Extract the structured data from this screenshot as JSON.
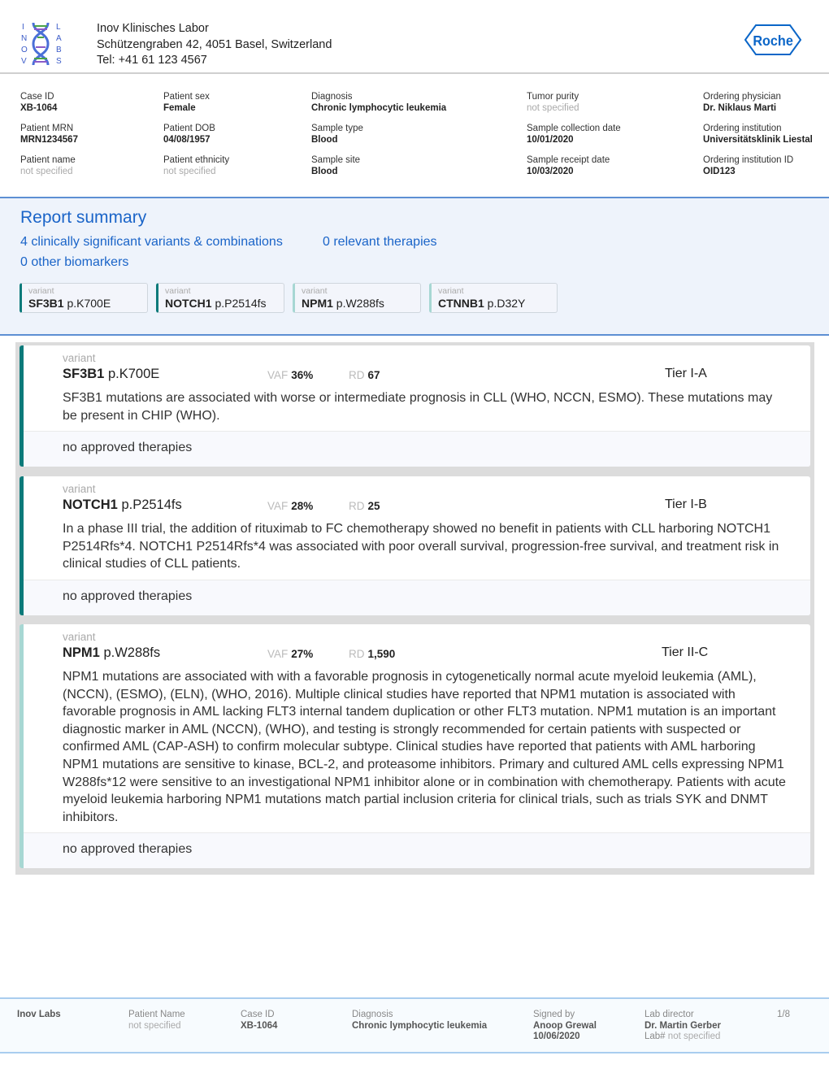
{
  "header": {
    "logo_text": "INOV LABS",
    "lab_name": "Inov Klinisches Labor",
    "address": "Schützengraben 42, 4051 Basel, Switzerland",
    "tel": "Tel: +41 61 123 4567",
    "brand": "Roche"
  },
  "info": [
    {
      "label": "Case ID",
      "value": "XB-1064"
    },
    {
      "label": "Patient sex",
      "value": "Female"
    },
    {
      "label": "Diagnosis",
      "value": "Chronic lymphocytic leukemia"
    },
    {
      "label": "Tumor purity",
      "value": "not specified"
    },
    {
      "label": "Ordering physician",
      "value": "Dr. Niklaus Marti"
    },
    {
      "label": "Patient MRN",
      "value": "MRN1234567"
    },
    {
      "label": "Patient DOB",
      "value": "04/08/1957"
    },
    {
      "label": "Sample type",
      "value": "Blood"
    },
    {
      "label": "Sample collection date",
      "value": "10/01/2020"
    },
    {
      "label": "Ordering institution",
      "value": "Universitätsklinik Liestal"
    },
    {
      "label": "Patient name",
      "value": "not specified"
    },
    {
      "label": "Patient ethnicity",
      "value": "not specified"
    },
    {
      "label": "Sample site",
      "value": "Blood"
    },
    {
      "label": "Sample receipt date",
      "value": "10/03/2020"
    },
    {
      "label": "Ordering institution ID",
      "value": "OID123"
    }
  ],
  "summary": {
    "title": "Report summary",
    "variants_link": "4 clinically significant variants & combinations",
    "therapies_link": "0 relevant therapies",
    "biomarkers_link": "0 other biomarkers",
    "chips": [
      {
        "label": "variant",
        "gene": "SF3B1",
        "change": "p.K700E"
      },
      {
        "label": "variant",
        "gene": "NOTCH1",
        "change": "p.P2514fs"
      },
      {
        "label": "variant",
        "gene": "NPM1",
        "change": "p.W288fs"
      },
      {
        "label": "variant",
        "gene": "CTNNB1",
        "change": "p.D32Y"
      }
    ]
  },
  "colors": {
    "accent": "#1a64c8",
    "tier1": "#0b7a7a",
    "tier2": "#a7d7d3"
  },
  "cards": [
    {
      "label": "variant",
      "gene": "SF3B1",
      "change": "p.K700E",
      "vaf_label": "VAF",
      "vaf": "36%",
      "rd_label": "RD",
      "rd": "67",
      "tier": "Tier I-A",
      "description": "SF3B1 mutations are associated with worse or intermediate prognosis in CLL (WHO, NCCN, ESMO). These mutations may be present in CHIP (WHO).",
      "therapies": "no approved therapies"
    },
    {
      "label": "variant",
      "gene": "NOTCH1",
      "change": "p.P2514fs",
      "vaf_label": "VAF",
      "vaf": "28%",
      "rd_label": "RD",
      "rd": "25",
      "tier": "Tier I-B",
      "description": "In a phase III trial, the addition of rituximab to FC chemotherapy showed no benefit in patients with CLL harboring NOTCH1 P2514Rfs*4. NOTCH1 P2514Rfs*4 was associated with poor overall survival, progression-free survival, and treatment risk in clinical studies of CLL patients.",
      "therapies": "no approved therapies"
    },
    {
      "label": "variant",
      "gene": "NPM1",
      "change": "p.W288fs",
      "vaf_label": "VAF",
      "vaf": "27%",
      "rd_label": "RD",
      "rd": "1,590",
      "tier": "Tier II-C",
      "description": "NPM1 mutations are associated with with a favorable prognosis in cytogenetically normal acute myeloid leukemia (AML), (NCCN), (ESMO), (ELN), (WHO, 2016). Multiple clinical studies have reported that NPM1 mutation is associated with favorable prognosis in AML lacking FLT3 internal tandem duplication or other FLT3 mutation. NPM1 mutation is an important diagnostic marker in AML (NCCN), (WHO), and testing is strongly recommended for certain patients with suspected or confirmed AML (CAP-ASH) to confirm molecular subtype. Clinical studies have reported that patients with AML harboring NPM1 mutations are sensitive to kinase, BCL-2, and proteasome inhibitors. Primary and cultured AML cells expressing NPM1 W288fs*12 were sensitive to an investigational NPM1 inhibitor alone or in combination with chemotherapy. Patients with acute myeloid leukemia harboring NPM1 mutations match partial inclusion criteria for clinical trials, such as trials SYK and DNMT inhibitors.",
      "therapies": "no approved therapies"
    }
  ],
  "footer": {
    "lab": "Inov Labs",
    "patient_label": "Patient Name",
    "patient": "not specified",
    "case_label": "Case ID",
    "case": "XB-1064",
    "diag_label": "Diagnosis",
    "diag": "Chronic lymphocytic leukemia",
    "signed_label": "Signed by",
    "signed": "Anoop Grewal",
    "signed_date": "10/06/2020",
    "director_label": "Lab director",
    "director": "Dr. Martin Gerber",
    "labno_label": "Lab#",
    "labno": "not specified",
    "page": "1/8"
  }
}
